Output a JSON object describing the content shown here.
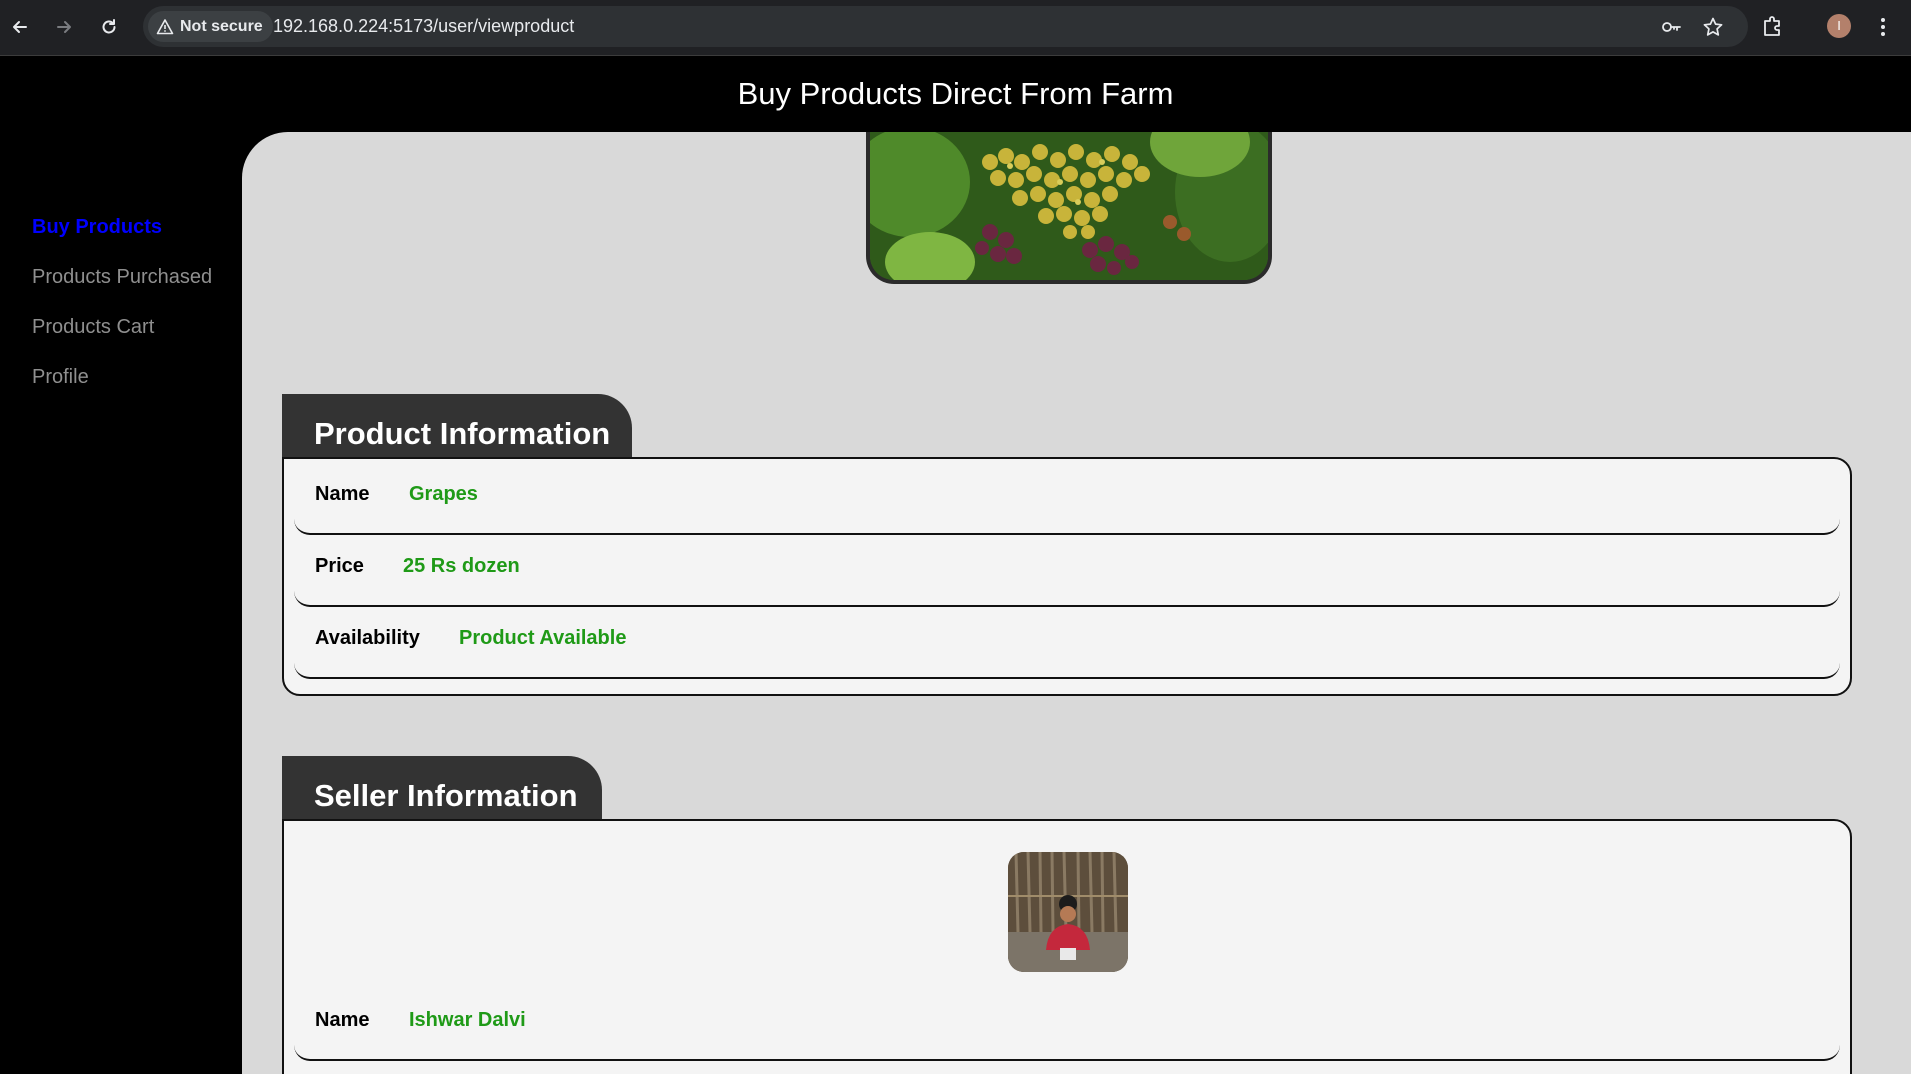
{
  "browser": {
    "security_label": "Not secure",
    "url": "192.168.0.224:5173/user/viewproduct",
    "profile_initial": "I"
  },
  "header": {
    "title": "Buy Products Direct From Farm"
  },
  "sidebar": {
    "items": [
      {
        "label": "Buy Products",
        "active": true
      },
      {
        "label": "Products Purchased",
        "active": false
      },
      {
        "label": "Products Cart",
        "active": false
      },
      {
        "label": "Profile",
        "active": false
      }
    ]
  },
  "product_info": {
    "title": "Product Information",
    "rows": [
      {
        "label": "Name",
        "value": "Grapes"
      },
      {
        "label": "Price",
        "value": "25 Rs dozen"
      },
      {
        "label": "Availability",
        "value": "Product Available"
      }
    ]
  },
  "seller_info": {
    "title": "Seller Information",
    "rows": [
      {
        "label": "Name",
        "value": "Ishwar Dalvi"
      }
    ]
  },
  "colors": {
    "accent_value": "#1f9a17",
    "active_link": "#0000ff",
    "panel_bg": "#d9d9d9",
    "tab_bg": "#333333"
  }
}
